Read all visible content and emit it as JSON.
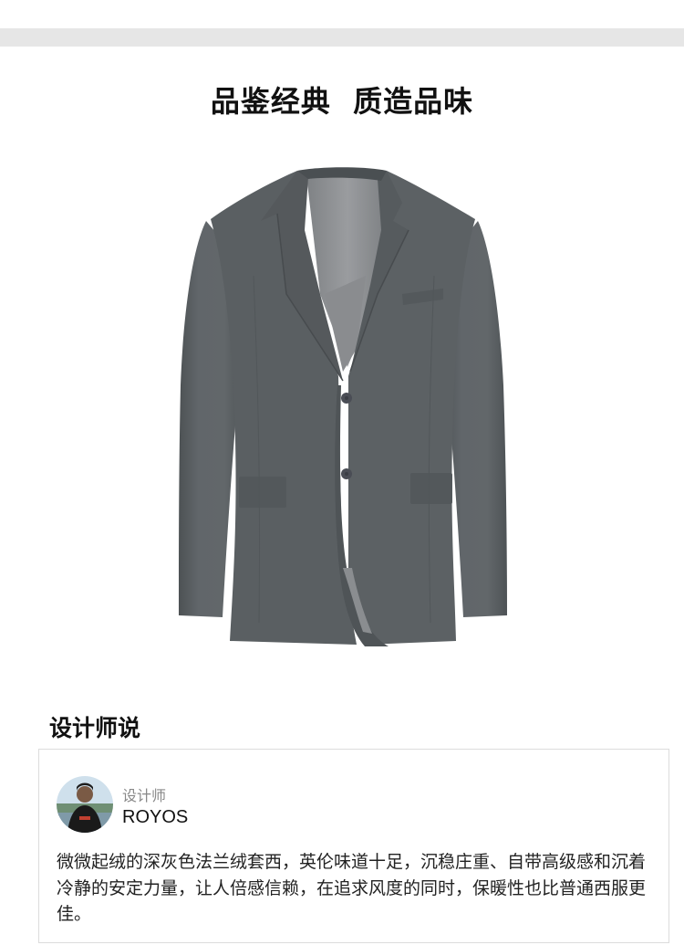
{
  "header": {
    "headline": "品鉴经典  质造品味"
  },
  "product": {
    "image_subject": "grey-flannel-suit-jacket",
    "colors": {
      "jacket": "#5b6062",
      "lining": "#8c8e91",
      "button": "#4a4d55"
    }
  },
  "designer_section": {
    "title": "设计师说",
    "role_label": "设计师",
    "name": "ROYOS",
    "quote": "微微起绒的深灰色法兰绒套西，英伦味道十足，沉稳庄重、自带高级感和沉着冷静的安定力量，让人倍感信赖，在追求风度的同时，保暖性也比普通西服更佳。"
  }
}
